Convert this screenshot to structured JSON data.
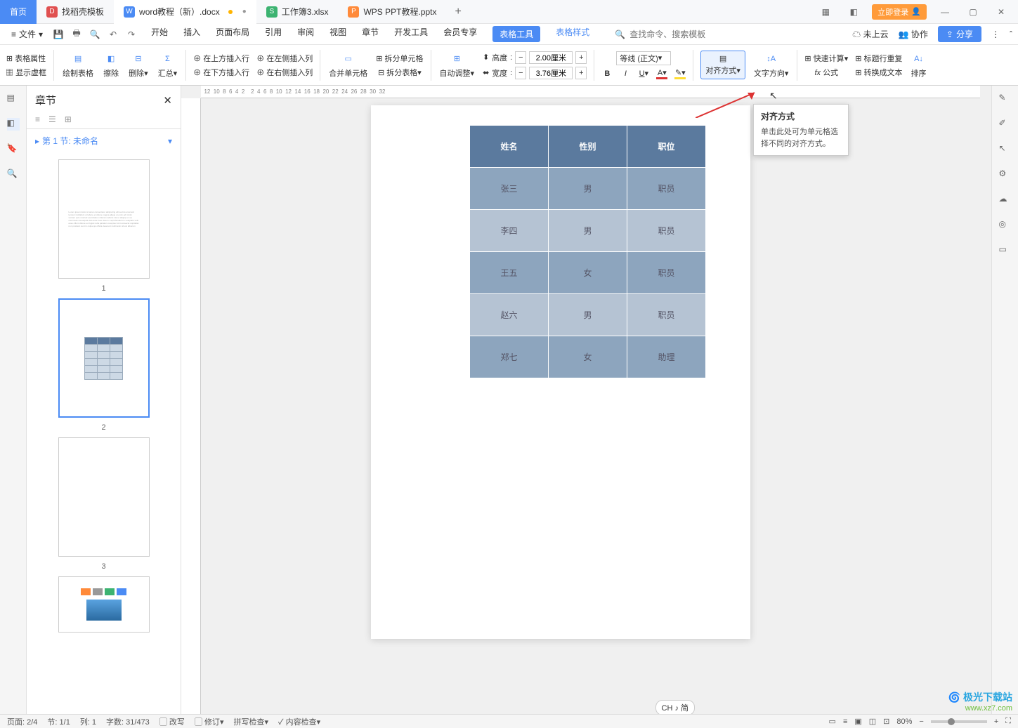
{
  "titlebar": {
    "home": "首页",
    "tabs": [
      {
        "icon": "D",
        "color": "#e05050",
        "label": "找稻壳模板"
      },
      {
        "icon": "W",
        "color": "#4b8bf4",
        "label": "word教程（新）.docx",
        "active": true,
        "mod": true
      },
      {
        "icon": "S",
        "color": "#3cb371",
        "label": "工作簿3.xlsx"
      },
      {
        "icon": "P",
        "color": "#ff8a3a",
        "label": "WPS PPT教程.pptx"
      }
    ],
    "login": "立即登录"
  },
  "menu": {
    "file": "文件",
    "items": [
      "开始",
      "插入",
      "页面布局",
      "引用",
      "审阅",
      "视图",
      "章节",
      "开发工具",
      "会员专享"
    ],
    "current": "表格工具",
    "style": "表格样式",
    "search_ph": "查找命令、搜索模板",
    "cloud": "未上云",
    "coop": "协作",
    "share": "分享"
  },
  "ribbon": {
    "table_props": "表格属性",
    "show_grid": "显示虚框",
    "draw": "绘制表格",
    "erase": "擦除",
    "delete": "删除",
    "summary": "汇总",
    "ins_above": "在上方插入行",
    "ins_below": "在下方插入行",
    "ins_left": "在左侧插入列",
    "ins_right": "在右侧插入列",
    "merge": "合并单元格",
    "split_cell": "拆分单元格",
    "split_table": "拆分表格",
    "autofit": "自动调整",
    "height": "高度",
    "width": "宽度",
    "h_val": "2.00厘米",
    "w_val": "3.76厘米",
    "font": "等线 (正文)",
    "align": "对齐方式",
    "text_dir": "文字方向",
    "quick_calc": "快速计算",
    "title_repeat": "标题行重复",
    "formula": "公式",
    "to_text": "转换成文本",
    "sort": "排序"
  },
  "tooltip": {
    "title": "对齐方式",
    "body": "单击此处可为单元格选择不同的对齐方式。"
  },
  "nav": {
    "title": "章节",
    "section": "第 1 节: 未命名",
    "pages": [
      "1",
      "2",
      "3"
    ]
  },
  "table": {
    "headers": [
      "姓名",
      "性别",
      "职位"
    ],
    "rows": [
      [
        "张三",
        "男",
        "职员"
      ],
      [
        "李四",
        "男",
        "职员"
      ],
      [
        "王五",
        "女",
        "职员"
      ],
      [
        "赵六",
        "男",
        "职员"
      ],
      [
        "郑七",
        "女",
        "助理"
      ]
    ]
  },
  "status": {
    "page": "页面: 2/4",
    "sec": "节: 1/1",
    "col": "列: 1",
    "chars": "字数: 31/473",
    "rev": "改写",
    "track": "修订",
    "spell": "拼写检查",
    "content": "内容检查",
    "lang": "CH ♪ 简",
    "zoom": "80%"
  },
  "watermark": {
    "brand": "极光下载站",
    "url": "www.xz7.com"
  }
}
